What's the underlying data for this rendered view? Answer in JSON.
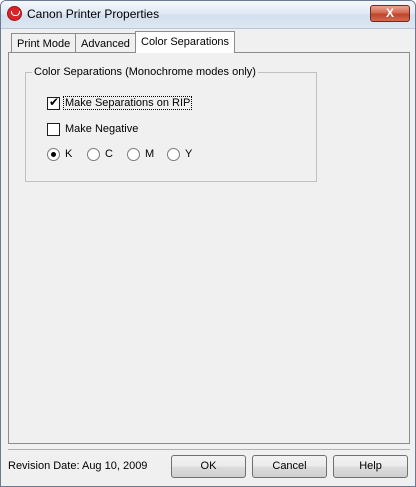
{
  "window": {
    "title": "Canon Printer Properties",
    "close_glyph": "X"
  },
  "tabs": [
    {
      "label": "Print Mode",
      "active": false
    },
    {
      "label": "Advanced",
      "active": false
    },
    {
      "label": "Color Separations",
      "active": true
    }
  ],
  "group": {
    "label": "Color Separations (Monochrome modes only)",
    "make_separations": {
      "label": "Make Separations on RIP",
      "checked": true
    },
    "make_negative": {
      "label": "Make Negative",
      "checked": false
    },
    "radios": [
      {
        "label": "K",
        "selected": true
      },
      {
        "label": "C",
        "selected": false
      },
      {
        "label": "M",
        "selected": false
      },
      {
        "label": "Y",
        "selected": false
      }
    ]
  },
  "footer": {
    "revision": "Revision Date: Aug 10, 2009",
    "ok_label": "OK",
    "cancel_label": "Cancel",
    "help_label": "Help"
  },
  "glyphs": {
    "check": "✔"
  }
}
